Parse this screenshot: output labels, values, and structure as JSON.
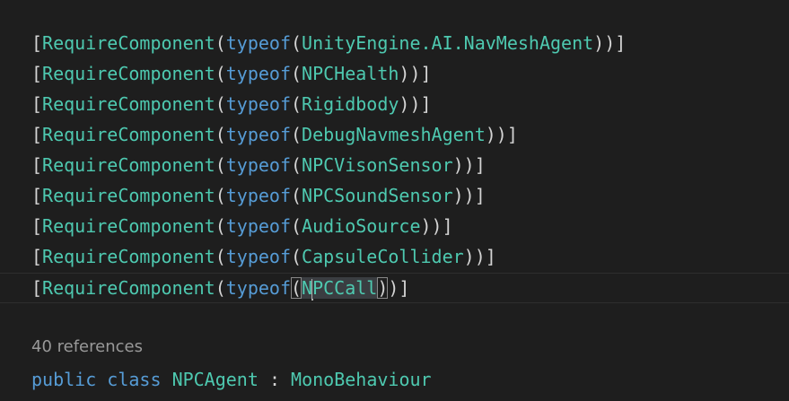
{
  "attribute_name": "RequireComponent",
  "keyword_typeof": "typeof",
  "lines": [
    {
      "type": "UnityEngine.AI.NavMeshAgent"
    },
    {
      "type": "NPCHealth"
    },
    {
      "type": "Rigidbody"
    },
    {
      "type": "DebugNavmeshAgent"
    },
    {
      "type": "NPCVisonSensor"
    },
    {
      "type": "NPCSoundSensor"
    },
    {
      "type": "AudioSource"
    },
    {
      "type": "CapsuleCollider"
    }
  ],
  "current_line": {
    "type_before_cursor": "N",
    "type_after_cursor": "PCCall"
  },
  "codelens": "40 references",
  "declaration": {
    "kw_public": "public",
    "kw_class": "class",
    "class_name": "NPCAgent",
    "colon": ":",
    "base_class": "MonoBehaviour"
  },
  "colors": {
    "background": "#1e1e1e",
    "keyword": "#569cd6",
    "type": "#4ec9b0",
    "punctuation": "#d4d4d4",
    "codelens": "#999999"
  }
}
